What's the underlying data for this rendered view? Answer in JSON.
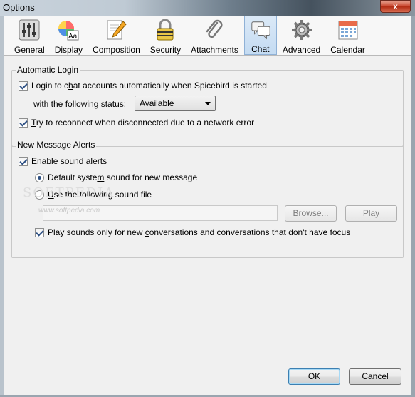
{
  "window": {
    "title": "Options",
    "close_glyph": "x"
  },
  "toolbar": {
    "tabs": [
      {
        "label": "General",
        "icon": "sliders-icon"
      },
      {
        "label": "Display",
        "icon": "color-wheel-icon"
      },
      {
        "label": "Composition",
        "icon": "pencil-paper-icon"
      },
      {
        "label": "Security",
        "icon": "padlock-icon"
      },
      {
        "label": "Attachments",
        "icon": "paperclip-icon"
      },
      {
        "label": "Chat",
        "icon": "speech-bubbles-icon",
        "selected": true
      },
      {
        "label": "Advanced",
        "icon": "gear-icon"
      },
      {
        "label": "Calendar",
        "icon": "calendar-icon"
      }
    ]
  },
  "automatic_login": {
    "title": "Automatic Login",
    "login_label_pre": "Login to c",
    "login_label_u": "h",
    "login_label_post": "at accounts automatically when Spicebird is started",
    "status_label_pre": "with the following stat",
    "status_label_u": "u",
    "status_label_post": "s:",
    "status_value": "Available",
    "reconnect_label_pre": "",
    "reconnect_label_u": "T",
    "reconnect_label_post": "ry to reconnect when disconnected due to a network error"
  },
  "alerts": {
    "title": "New Message Alerts",
    "enable_label_pre": "Enable ",
    "enable_label_u": "s",
    "enable_label_post": "ound alerts",
    "default_sound_pre": "Default syste",
    "default_sound_u": "m",
    "default_sound_post": " sound for new message",
    "use_file_pre": "",
    "use_file_u": "U",
    "use_file_post": "se the following sound file",
    "browse_label": "Browse...",
    "play_label": "Play",
    "focus_label_pre": "Play sounds only for new ",
    "focus_label_u": "c",
    "focus_label_post": "onversations and conversations that don't have focus"
  },
  "footer": {
    "ok_label": "OK",
    "cancel_label": "Cancel"
  },
  "watermark": {
    "small": "www.softpedia.com",
    "big": "SOFTPEDIA"
  },
  "colors": {
    "accent": "#2b4e83",
    "selected_tab_bg": "#c4dbf2",
    "close_button": "#c8432b"
  }
}
